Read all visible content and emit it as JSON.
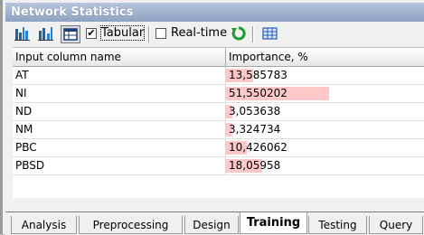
{
  "window": {
    "title": "Network Statistics"
  },
  "toolbar": {
    "icons": [
      "bar-chart-icon",
      "bar-chart-alt-icon",
      "table-view-icon",
      "refresh-icon",
      "grid-icon"
    ],
    "tabular": {
      "label": "Tabular",
      "checked": true
    },
    "realtime": {
      "label": "Real-time",
      "checked": false
    }
  },
  "table": {
    "columns": [
      "Input column name",
      "Importance, %"
    ],
    "rows": [
      {
        "name": "AT",
        "value": "13,585783",
        "importance": 13.585783
      },
      {
        "name": "NI",
        "value": "51,550202",
        "importance": 51.550202
      },
      {
        "name": "ND",
        "value": "3,053638",
        "importance": 3.053638
      },
      {
        "name": "NM",
        "value": "3,324734",
        "importance": 3.324734
      },
      {
        "name": "PBC",
        "value": "10,426062",
        "importance": 10.426062
      },
      {
        "name": "PBSD",
        "value": "18,05958",
        "importance": 18.05958
      }
    ],
    "bar_color": "#ffc8c8"
  },
  "tabs": [
    {
      "label": "Analysis",
      "active": false
    },
    {
      "label": "Preprocessing",
      "active": false
    },
    {
      "label": "Design",
      "active": false
    },
    {
      "label": "Training",
      "active": true
    },
    {
      "label": "Testing",
      "active": false
    },
    {
      "label": "Query",
      "active": false
    }
  ]
}
